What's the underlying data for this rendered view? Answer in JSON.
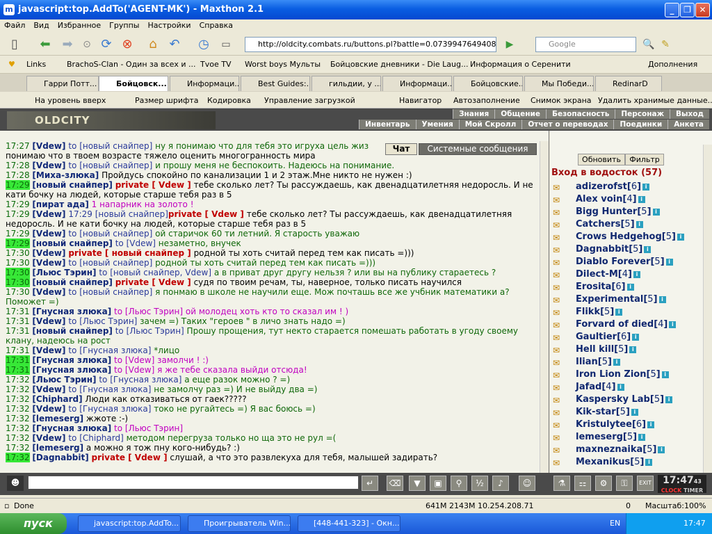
{
  "window": {
    "title": "javascript:top.AddTo('AGENT-MK') - Maxthon 2.1"
  },
  "menu": [
    "Файл",
    "Вид",
    "Избранное",
    "Группы",
    "Настройки",
    "Справка"
  ],
  "address": {
    "url": "http://oldcity.combats.ru/buttons.pl?battle=0.0739947649408634",
    "search_placeholder": "Google"
  },
  "links": [
    "Links",
    "BrachoS-Clan - Один за всех и ...",
    "Tvoe TV",
    "Worst boys Мульты",
    "Бойцовские дневники - Die Laug...",
    "Информация о Серенити",
    "Дополнения"
  ],
  "tabs": [
    {
      "label": "Гарри Потт..."
    },
    {
      "label": "Бойцовск...",
      "active": true
    },
    {
      "label": "Информаци..."
    },
    {
      "label": "Best Guides:..."
    },
    {
      "label": "гильдии, у ..."
    },
    {
      "label": "Информаци..."
    },
    {
      "label": "Бойцовские..."
    },
    {
      "label": "Мы Победи..."
    },
    {
      "label": "RedinarD"
    }
  ],
  "navbar": [
    "На уровень вверх",
    "Размер шрифта",
    "Кодировка",
    "Управление загрузкой",
    "Навигатор",
    "Автозаполнение",
    "Снимок экрана",
    "Удалить хранимые данные..."
  ],
  "game": {
    "logo": "OLDCITY",
    "menu_top": [
      "Знания",
      "Общение",
      "Безопасность",
      "Персонаж",
      "Выход"
    ],
    "menu_bottom": [
      "Инвентарь",
      "Умения",
      "Мой Скролл",
      "Отчет о переводах",
      "Поединки",
      "Анкета"
    ],
    "chat_tabs": {
      "chat": "Чат",
      "system": "Системные сообщения"
    },
    "right": {
      "refresh": "Обновить",
      "filter": "Фильтр",
      "room": "Вход в водосток (57)"
    },
    "clock": "17:47",
    "clock_sec": "43",
    "clock_labels": [
      "CLOCK",
      "TIMER"
    ]
  },
  "chat": [
    {
      "t": "17:27",
      "n": "[Vdew]",
      "to": "to [новый снайпер]",
      "m": " ну я понимаю что для тебя это игруха цель жиз"
    },
    {
      "t": "",
      "n": "",
      "to": "",
      "m": "понимаю что в твоем возрасте тяжело оценить многогранность мира"
    },
    {
      "t": "17:28",
      "n": "[Vdew]",
      "to": "to [новый снайпер]",
      "m": " и прошу меня не беспокоить. Надеюсь на понимание."
    },
    {
      "t": "17:28",
      "n": "[Миха-злюка]",
      "to": "",
      "m": "  Пройдусь спокойно по канализации 1 и 2 этаж.Мне никто не нужен :)"
    },
    {
      "t": "17:29",
      "hl": true,
      "n": "[новый снайпер]",
      "prv": "private [ Vdew ]",
      "m": " тебе сколько лет? Ты рассуждаешь, как двенадцатилетняя недоросль. И не кати бочку на людей, которые старше тебя раз в 5"
    },
    {
      "t": "17:29",
      "n": "[пират ада]",
      "pink": " 1 напарник на золото !"
    },
    {
      "t": "17:29",
      "n": "[Vdew]",
      "to": "17:29 [новый снайпер]",
      "prv": "private [ Vdew ]",
      "m": " тебе сколько лет? Ты рассуждаешь, как двенадцатилетняя недоросль. И не кати бочку на людей, которые старше тебя раз в 5"
    },
    {
      "t": "17:29",
      "n": "[Vdew]",
      "to": "to [новый снайпер]",
      "m": " ой старичок 60 ти летний. Я старость уважаю"
    },
    {
      "t": "17:29",
      "hl": true,
      "n": "[новый снайпер]",
      "to": "to [Vdew]",
      "m": " незаметно, внучек"
    },
    {
      "t": "17:30",
      "n": "[Vdew]",
      "prv": "private [ новый снайпер ]",
      "m": " родной ты хоть считай перед тем как писать =)))"
    },
    {
      "t": "17:30",
      "n": "[Vdew]",
      "to": "to [новый снайпер]",
      "m": " родной ты хоть считай перед тем как писать =)))"
    },
    {
      "t": "17:30",
      "hl": true,
      "n": "[Льюс Тэрин]",
      "to": "to [новый снайпер, Vdew]",
      "m": " а в приват друг другу нельзя ? или вы на публику стараетесь ?"
    },
    {
      "t": "17:30",
      "hl": true,
      "n": "[новый снайпер]",
      "prv": "private [ Vdew ]",
      "m": " судя по твоим речам, ты, наверное, только писать научился"
    },
    {
      "t": "17:30",
      "n": "[Vdew]",
      "to": "to [новый снайпер]",
      "m": " я понмаю в школе не научили еще. Мож почташь все же учбник математики а? Поможет =)"
    },
    {
      "t": "17:31",
      "n": "[Гнусная злюка]",
      "pink": " to [Льюс Тэрин] ой молодец хоть кто то сказал им ! )"
    },
    {
      "t": "17:31",
      "n": "[Vdew]",
      "to": "to [Льюс Тэрин]",
      "m": " зачем =) Таких \"героев \" в личо знать надо =)"
    },
    {
      "t": "17:31",
      "n": "[новый снайпер]",
      "to": "to [Льюс Тэрин]",
      "m": " Прошу прощения, тут некто старается помешать работать в угоду своему клану, надеюсь на рост"
    },
    {
      "t": "17:31",
      "n": "[Vdew]",
      "to": "to [Гнусная злюка]",
      "m": " *лицо"
    },
    {
      "t": "17:31",
      "hl": true,
      "n": "[Гнусная злюка]",
      "pinkto": "to [Vdew]",
      "pink": " замолчи ! :)"
    },
    {
      "t": "17:31",
      "hl": true,
      "n": "[Гнусная злюка]",
      "pinkto": "to [Vdew]",
      "pink": " я же тебе сказала выйди отсюда!"
    },
    {
      "t": "17:32",
      "n": "[Льюс Тэрин]",
      "to": "to [Гнусная злюка]",
      "m": " а еще разок можно ? =)"
    },
    {
      "t": "17:32",
      "n": "[Vdew]",
      "to": "to [Гнусная злюка]",
      "m": " не замолчу раз =) И не выйду два =)"
    },
    {
      "t": "17:32",
      "n": "[Chiphard]",
      "m": " Люди как отказиваться от гаек?????"
    },
    {
      "t": "17:32",
      "n": "[Vdew]",
      "to": "to [Гнусная злюка]",
      "m": " токо не ругайтесь =) Я вас боюсь =)"
    },
    {
      "t": "17:32",
      "n": "[lemeserg]",
      "m": " жжоте :-)"
    },
    {
      "t": "17:32",
      "n": "[Гнусная злюка]",
      "pink": " to [Льюс Тэрин] "
    },
    {
      "t": "17:32",
      "n": "[Vdew]",
      "to": "to [Chiphard]",
      "m": " методом перегруза только но ща это не рул =("
    },
    {
      "t": "17:32",
      "n": "[lemeserg]",
      "m": " а можно я тож пну кого-нибудь? :)"
    },
    {
      "t": "17:32",
      "hl": true,
      "n": "[Dagnabbit]",
      "prv": "private [ Vdew ]",
      "m": " слушай, а что это развлекуха для тебя, малышей задирать?"
    }
  ],
  "users": [
    {
      "n": "adizerofst",
      "l": "6"
    },
    {
      "n": "Alex voin",
      "l": "4"
    },
    {
      "n": "Bigg Hunter",
      "l": "5"
    },
    {
      "n": "Catchers",
      "l": "5"
    },
    {
      "n": "Crows Hedgehog",
      "l": "5"
    },
    {
      "n": "Dagnabbit",
      "l": "5"
    },
    {
      "n": "Diablo Forever",
      "l": "5"
    },
    {
      "n": "Dilect-M",
      "l": "4"
    },
    {
      "n": "Erosita",
      "l": "6"
    },
    {
      "n": "Experimental",
      "l": "5"
    },
    {
      "n": "Flikk",
      "l": "5"
    },
    {
      "n": "Forvard of died",
      "l": "4"
    },
    {
      "n": "Gaultier",
      "l": "6"
    },
    {
      "n": "Hell kill",
      "l": "5"
    },
    {
      "n": "Ilian",
      "l": "5"
    },
    {
      "n": "Iron Lion Zion",
      "l": "5"
    },
    {
      "n": "Jafad",
      "l": "4"
    },
    {
      "n": "Kaspersky Lab",
      "l": "5"
    },
    {
      "n": "Kik-star",
      "l": "5"
    },
    {
      "n": "Kristulytee",
      "l": "6"
    },
    {
      "n": "lemeserg",
      "l": "5"
    },
    {
      "n": "maxneznaika",
      "l": "5"
    },
    {
      "n": "Mexanikus",
      "l": "5"
    }
  ],
  "status": {
    "done": "Done",
    "mem": "641M  2143M 10.254.208.71",
    "zero": "0",
    "zoom": "Масштаб:100%"
  },
  "taskbar": {
    "start": "пуск",
    "tasks": [
      "javascript:top.AddTo...",
      "Проигрыватель Win...",
      "[448-441-323] - Окн..."
    ],
    "lang": "EN",
    "time": "17:47"
  }
}
